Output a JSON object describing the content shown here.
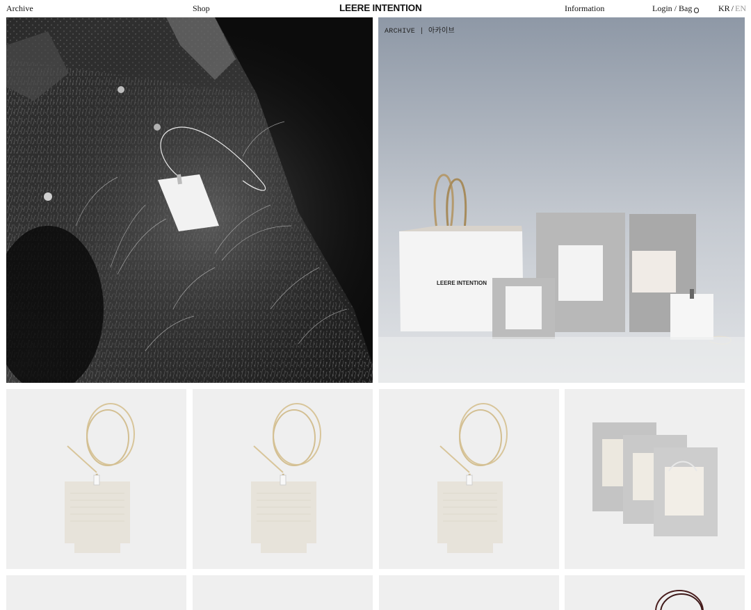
{
  "header": {
    "archive_label": "Archive",
    "shop_label": "Shop",
    "brand": "LEERE INTENTION",
    "information_label": "Information",
    "account_label": "Login / Bag",
    "bag_icon": "bag-icon",
    "lang_kr": "KR",
    "lang_separator": "/",
    "lang_en": "EN"
  },
  "hero": {
    "left_image": "black-and-white photo of paper tag hanging on grassy rock",
    "right_label": "ARCHIVE  |  아카이브",
    "right_bag_text": "LEERE INTENTION"
  },
  "products": [
    {
      "image": "paper-tag-with-cord",
      "row": 1
    },
    {
      "image": "paper-tag-with-cord",
      "row": 1
    },
    {
      "image": "paper-tag-with-cord",
      "row": 1
    },
    {
      "image": "stacked-packaged-cards",
      "row": 1
    },
    {
      "image": "blank",
      "row": 2
    },
    {
      "image": "blank",
      "row": 2
    },
    {
      "image": "blank",
      "row": 2
    },
    {
      "image": "dark-cord",
      "row": 2
    }
  ],
  "colors": {
    "text": "#111111",
    "muted": "#9a9a9a",
    "tile_bg": "#efefef"
  }
}
